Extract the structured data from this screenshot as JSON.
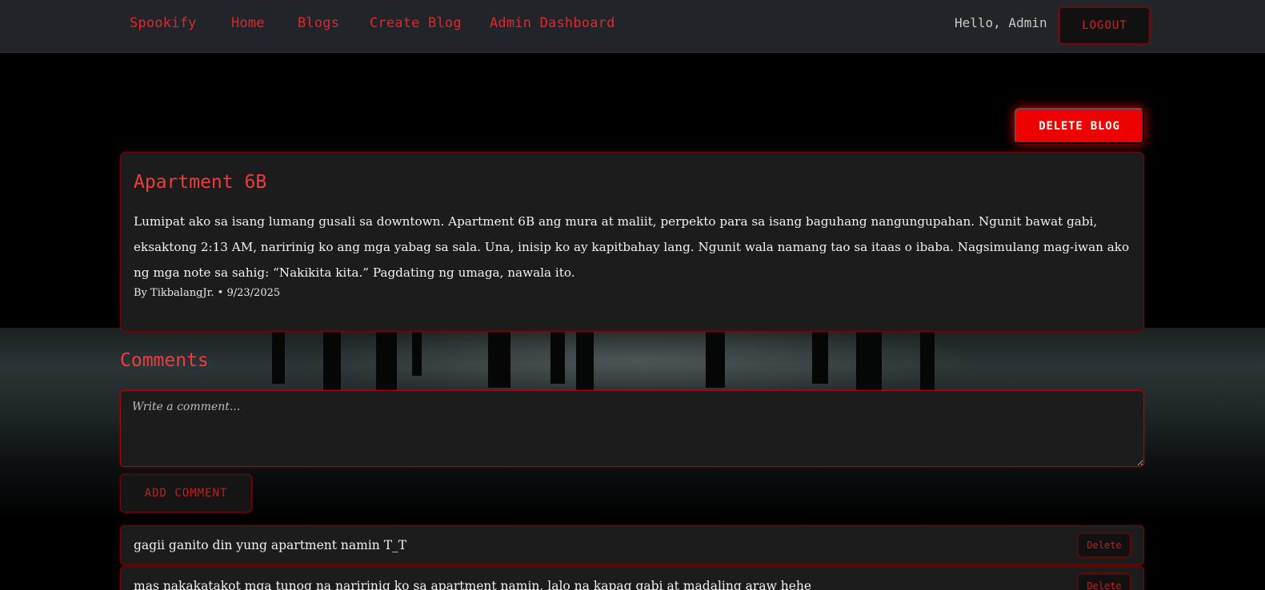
{
  "nav": {
    "brand": "Spookify",
    "links": [
      "Home",
      "Blogs",
      "Create Blog",
      "Admin Dashboard"
    ],
    "greeting": "Hello, Admin",
    "logout_label": "LOGOUT"
  },
  "post": {
    "delete_label": "DELETE BLOG",
    "title": "Apartment 6B",
    "body": "Lumipat ako sa isang lumang gusali sa downtown. Apartment 6B ang mura at maliit, perpekto para sa isang baguhang nangungupahan. Ngunit bawat gabi, eksaktong 2:13 AM, naririnig ko ang mga yabag sa sala. Una, inisip ko ay kapitbahay lang. Ngunit wala namang tao sa itaas o ibaba. Nagsimulang mag-iwan ako ng mga note sa sahig: “Nakikita kita.” Pagdating ng umaga, nawala ito.",
    "meta": "By TikbalangJr. • 9/23/2025"
  },
  "comments": {
    "heading": "Comments",
    "placeholder": "Write a comment...",
    "add_label": "ADD COMMENT",
    "delete_label": "Delete",
    "items": [
      "gagii ganito din yung apartment namin T_T",
      "mas nakakatakot mga tunog na naririnig ko sa apartment namin, lalo na kapag gabi at madaling araw hehe"
    ]
  },
  "colors": {
    "accent": "#e0262b",
    "card_bg": "#1c1c1c",
    "nav_bg": "#212529"
  }
}
